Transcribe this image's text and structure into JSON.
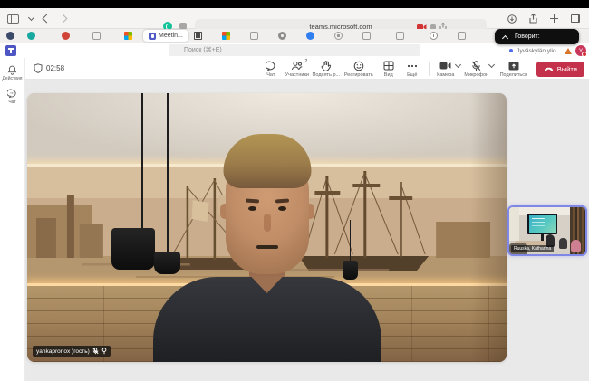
{
  "browser": {
    "url": "teams.microsoft.com",
    "tab_bar": {
      "active_tab_label": "Meetin..."
    },
    "toolbar_icons": [
      "sidebar-icon",
      "chevron-down-icon",
      "back-icon",
      "forward-icon",
      "grammarly-icon",
      "extension-icon",
      "camera-active-icon",
      "media-badge-icon",
      "reader-icon",
      "downloads-icon",
      "share-icon",
      "new-tab-icon",
      "tab-overview-icon"
    ]
  },
  "speaking_indicator": {
    "label": "Говорит:"
  },
  "teams_header": {
    "search_placeholder": "Поиск (⌘+E)",
    "org_name": "Jyväskylän ylio...",
    "avatar_initial": "Y"
  },
  "sidebar": {
    "items": [
      {
        "label": "Действия",
        "icon": "bell-icon"
      },
      {
        "label": "Чат",
        "icon": "chat-bubble-icon"
      }
    ]
  },
  "meeting_toolbar": {
    "timer": "02:58",
    "buttons": [
      {
        "label": "Чат",
        "icon": "chat-icon"
      },
      {
        "label": "Участники",
        "icon": "people-icon",
        "badge": "2"
      },
      {
        "label": "Поднять р...",
        "icon": "raise-hand-icon"
      },
      {
        "label": "Реагировать",
        "icon": "react-smiley-icon"
      },
      {
        "label": "Вид",
        "icon": "view-grid-icon"
      },
      {
        "label": "Ещё",
        "icon": "more-ellipsis-icon"
      },
      {
        "label": "Камера",
        "icon": "camera-on-icon",
        "has_chevron": true
      },
      {
        "label": "Микрофон",
        "icon": "mic-muted-icon",
        "has_chevron": true,
        "muted": true
      },
      {
        "label": "Поделиться",
        "icon": "screen-share-icon"
      },
      {
        "label": "Выйти",
        "icon": "hang-up-icon",
        "style": "danger"
      }
    ]
  },
  "stage": {
    "main_participant": {
      "name": "yankapronox (гость)",
      "muted": true,
      "pinned": true
    },
    "thumbnail": {
      "name": "Ruuska, Katharina"
    }
  },
  "colors": {
    "leave_red": "#c4314b",
    "thumbnail_border": "#7f88e6",
    "speaking_pill": "#0f0f0f",
    "stage_bg": "#e9e9e9"
  }
}
